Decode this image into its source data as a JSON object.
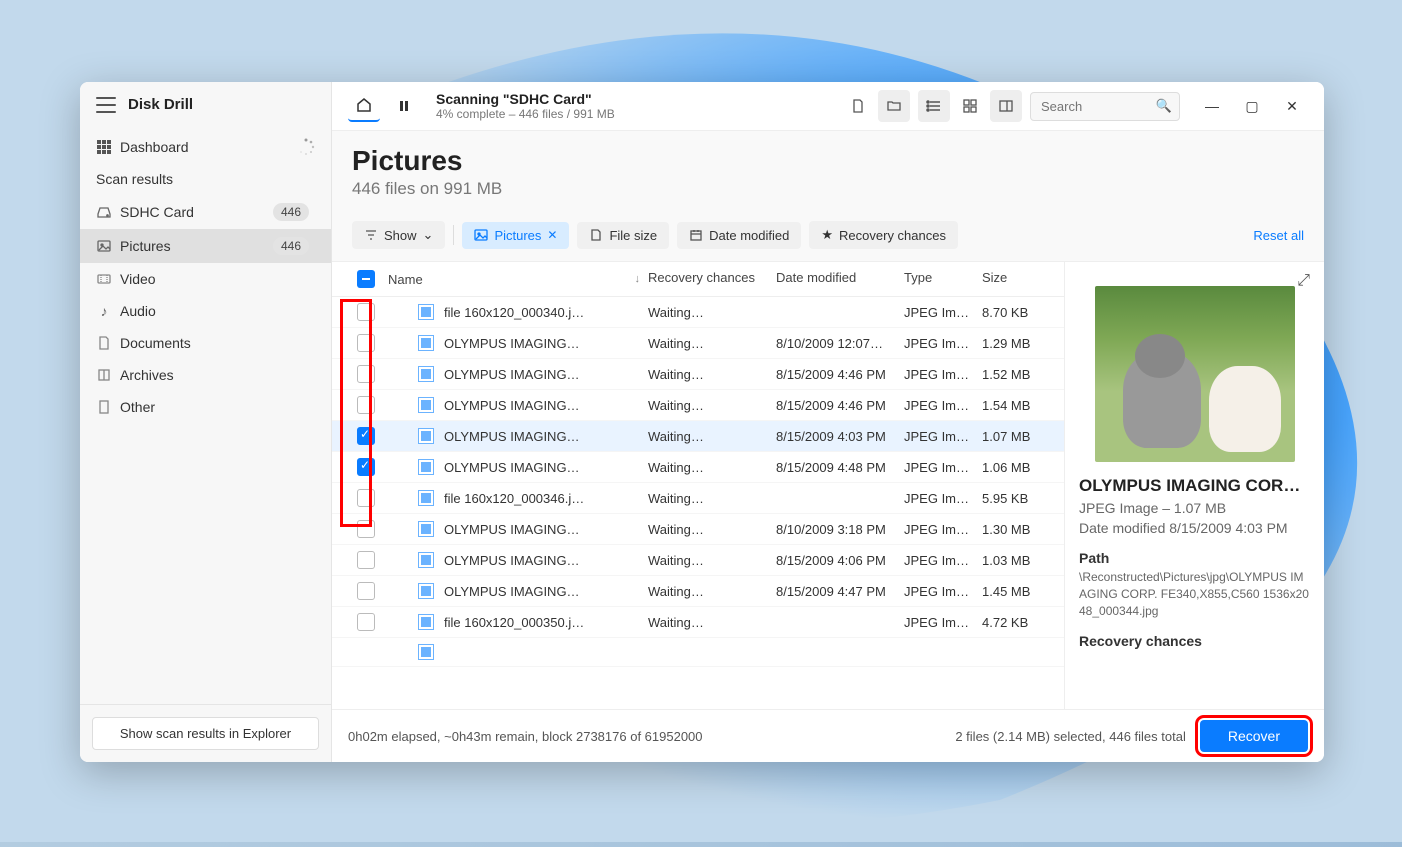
{
  "app": {
    "brand": "Disk Drill"
  },
  "sidebar": {
    "dashboard": "Dashboard",
    "section": "Scan results",
    "items": [
      {
        "label": "SDHC Card",
        "count": "446"
      },
      {
        "label": "Pictures",
        "count": "446"
      },
      {
        "label": "Video"
      },
      {
        "label": "Audio"
      },
      {
        "label": "Documents"
      },
      {
        "label": "Archives"
      },
      {
        "label": "Other"
      }
    ],
    "explorer_btn": "Show scan results in Explorer"
  },
  "topbar": {
    "title": "Scanning \"SDHC Card\"",
    "subtitle": "4% complete – 446 files / 991 MB",
    "search_placeholder": "Search"
  },
  "header": {
    "title": "Pictures",
    "subtitle": "446 files on 991 MB"
  },
  "filters": {
    "show": "Show",
    "pictures": "Pictures",
    "filesize": "File size",
    "date": "Date modified",
    "recovery": "Recovery chances",
    "reset": "Reset all"
  },
  "columns": {
    "name": "Name",
    "recovery": "Recovery chances",
    "date": "Date modified",
    "type": "Type",
    "size": "Size"
  },
  "rows": [
    {
      "name": "file 160x120_000340.j…",
      "rec": "Waiting…",
      "date": "",
      "type": "JPEG Im…",
      "size": "8.70 KB",
      "checked": false
    },
    {
      "name": "OLYMPUS IMAGING…",
      "rec": "Waiting…",
      "date": "8/10/2009 12:07…",
      "type": "JPEG Im…",
      "size": "1.29 MB",
      "checked": false
    },
    {
      "name": "OLYMPUS IMAGING…",
      "rec": "Waiting…",
      "date": "8/15/2009 4:46 PM",
      "type": "JPEG Im…",
      "size": "1.52 MB",
      "checked": false
    },
    {
      "name": "OLYMPUS IMAGING…",
      "rec": "Waiting…",
      "date": "8/15/2009 4:46 PM",
      "type": "JPEG Im…",
      "size": "1.54 MB",
      "checked": false
    },
    {
      "name": "OLYMPUS IMAGING…",
      "rec": "Waiting…",
      "date": "8/15/2009 4:03 PM",
      "type": "JPEG Im…",
      "size": "1.07 MB",
      "checked": true,
      "selected": true
    },
    {
      "name": "OLYMPUS IMAGING…",
      "rec": "Waiting…",
      "date": "8/15/2009 4:48 PM",
      "type": "JPEG Im…",
      "size": "1.06 MB",
      "checked": true
    },
    {
      "name": "file 160x120_000346.j…",
      "rec": "Waiting…",
      "date": "",
      "type": "JPEG Im…",
      "size": "5.95 KB",
      "checked": false
    },
    {
      "name": "OLYMPUS IMAGING…",
      "rec": "Waiting…",
      "date": "8/10/2009 3:18 PM",
      "type": "JPEG Im…",
      "size": "1.30 MB",
      "checked": false
    },
    {
      "name": "OLYMPUS IMAGING…",
      "rec": "Waiting…",
      "date": "8/15/2009 4:06 PM",
      "type": "JPEG Im…",
      "size": "1.03 MB",
      "checked": false
    },
    {
      "name": "OLYMPUS IMAGING…",
      "rec": "Waiting…",
      "date": "8/15/2009 4:47 PM",
      "type": "JPEG Im…",
      "size": "1.45 MB",
      "checked": false
    },
    {
      "name": "file 160x120_000350.j…",
      "rec": "Waiting…",
      "date": "",
      "type": "JPEG Im…",
      "size": "4.72 KB",
      "checked": false
    }
  ],
  "preview": {
    "title": "OLYMPUS IMAGING COR…",
    "meta1": "JPEG Image – 1.07 MB",
    "meta2": "Date modified 8/15/2009 4:03 PM",
    "path_label": "Path",
    "path": "\\Reconstructed\\Pictures\\jpg\\OLYMPUS IMAGING CORP. FE340,X855,C560 1536x2048_000344.jpg",
    "chances_label": "Recovery chances"
  },
  "footer": {
    "progress": "0h02m elapsed, ~0h43m remain, block 2738176 of 61952000",
    "status": "2 files (2.14 MB) selected, 446 files total",
    "recover": "Recover"
  }
}
